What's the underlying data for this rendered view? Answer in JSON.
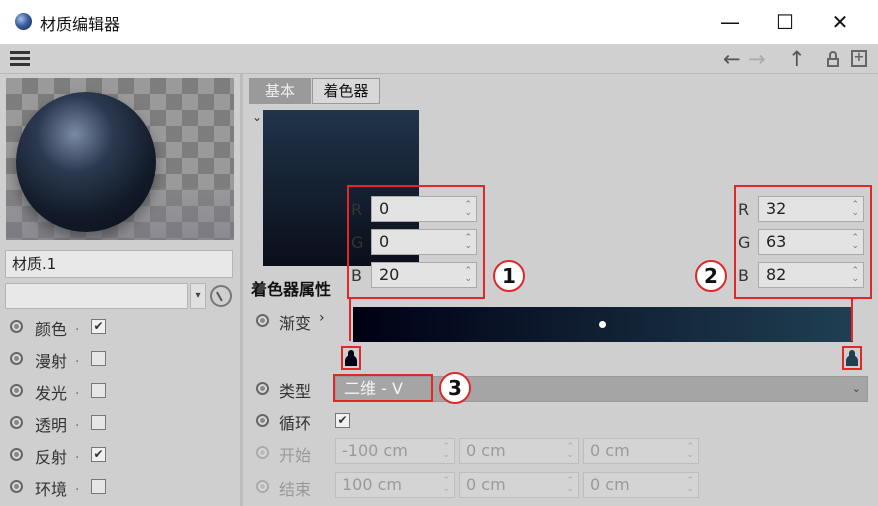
{
  "window": {
    "title": "材质编辑器",
    "minimize": "—",
    "maximize": "☐",
    "close": "✕"
  },
  "toolbar": {
    "back": "←",
    "forward": "→",
    "up": "↑",
    "new_window": "+"
  },
  "material": {
    "name": "材质.1"
  },
  "channels": [
    {
      "label": "颜色",
      "checked": true
    },
    {
      "label": "漫射",
      "checked": false
    },
    {
      "label": "发光",
      "checked": false
    },
    {
      "label": "透明",
      "checked": false
    },
    {
      "label": "反射",
      "checked": true
    },
    {
      "label": "环境",
      "checked": false
    }
  ],
  "tabs": [
    {
      "label": "基本",
      "active": false
    },
    {
      "label": "着色器",
      "active": true
    }
  ],
  "shader": {
    "section_title": "着色器属性",
    "left_color": {
      "R": "0",
      "G": "0",
      "B": "20"
    },
    "right_color": {
      "R": "32",
      "G": "63",
      "B": "82"
    },
    "gradient_label": "渐变",
    "gradient_arrow": "›",
    "type_label": "类型",
    "type_value": "二维 - V",
    "loop_label": "循环",
    "loop_checked": true,
    "start_label": "开始",
    "start_values": [
      "-100 cm",
      "0 cm",
      "0 cm"
    ],
    "end_label": "结束",
    "end_values": [
      "100 cm",
      "0 cm",
      "0 cm"
    ]
  },
  "annotations": [
    "1",
    "2",
    "3"
  ],
  "colors": {
    "annotation_red": "#e02828",
    "gradient_start": "#000014",
    "gradient_end": "#203f52"
  }
}
